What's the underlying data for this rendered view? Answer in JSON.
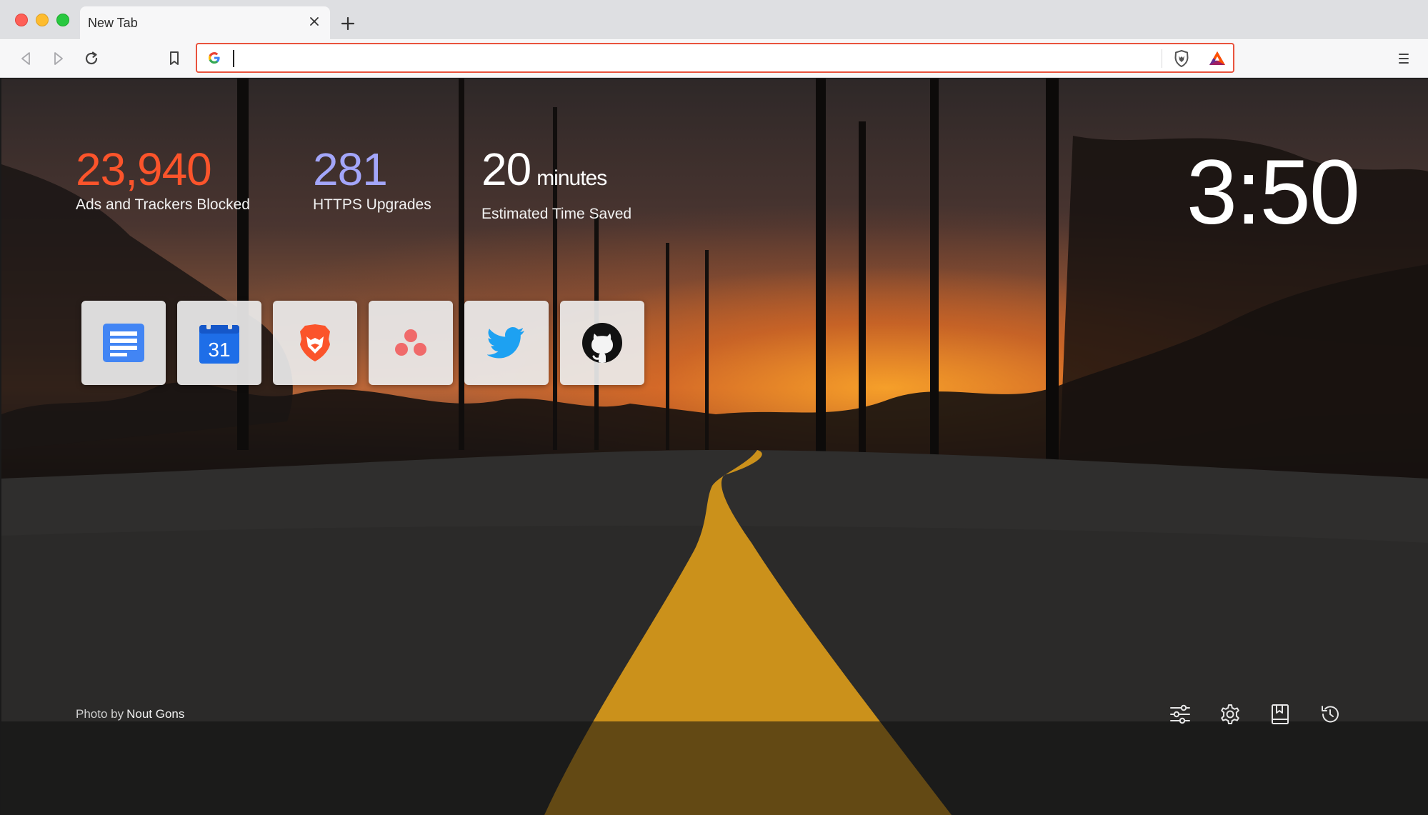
{
  "window": {
    "tab_title": "New Tab"
  },
  "toolbar": {
    "omnibox_value": "",
    "omnibox_engine_icon": "google-g-icon",
    "shield_icon": "brave-shield-icon",
    "rewards_icon": "bat-rewards-icon"
  },
  "stats": {
    "ads_blocked": {
      "value": "23,940",
      "label": "Ads and Trackers Blocked",
      "color": "#fb542b"
    },
    "https_upgrades": {
      "value": "281",
      "label": "HTTPS Upgrades",
      "color": "#a3a6fa"
    },
    "time_saved": {
      "value": "20",
      "unit": "minutes",
      "label": "Estimated Time Saved",
      "color": "#ffffff"
    }
  },
  "clock": "3:50",
  "top_sites": [
    {
      "icon": "google-docs-icon"
    },
    {
      "icon": "google-calendar-icon",
      "text": "31"
    },
    {
      "icon": "brave-lion-icon"
    },
    {
      "icon": "asana-icon"
    },
    {
      "icon": "twitter-bird-icon"
    },
    {
      "icon": "github-octocat-icon"
    }
  ],
  "photo_credit": {
    "prefix": "Photo by",
    "author": "Nout Gons"
  },
  "ntp_actions": [
    {
      "icon": "customize-sliders-icon"
    },
    {
      "icon": "settings-gear-icon"
    },
    {
      "icon": "bookmarks-icon"
    },
    {
      "icon": "history-icon"
    }
  ],
  "colors": {
    "accent": "#fb542b",
    "omnibox_border": "#e9533d"
  }
}
